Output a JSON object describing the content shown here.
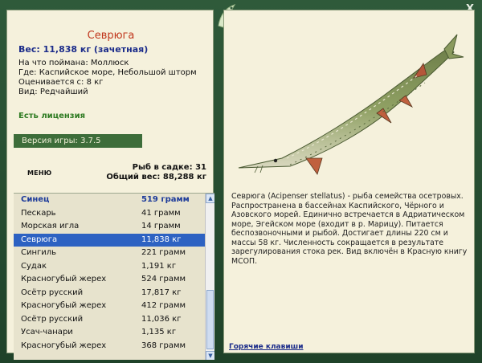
{
  "window": {
    "close_label": "X"
  },
  "fish": {
    "name": "Севрюга",
    "weight_line": "Вес: 11,838 кг (зачетная)",
    "bait": "На что поймана: Моллюск",
    "place": "Где: Каспийское море, Небольшой шторм",
    "value": "Оценивается с: 8 кг",
    "kind": "Вид: Редчайший",
    "license": "Есть лицензия",
    "description": "Севрюга (Acipenser stellatus) - рыба семейства осетровых. Распространена в бассейнах Каспийского, Чёрного и Азовского морей. Единично встречается в Адриатическом море, Эгейском море (входит в р. Марицу). Питается беспозвоночными и рыбой. Достигает длины 220 см и массы 58 кг. Численность сокращается в результате зарегулирования стока рек. Вид включён в Красную книгу МСОП."
  },
  "game": {
    "version": "Версия игры: 3.7.5"
  },
  "menu": {
    "label": "МЕНЮ"
  },
  "totals": {
    "count_line": "Рыб в садке: 31",
    "weight_line": "Общий вес: 88,288 кг"
  },
  "catch_list": [
    {
      "name": "Синец",
      "weight": "519 грамм",
      "state": "header"
    },
    {
      "name": "Пескарь",
      "weight": "41 грамм",
      "state": "normal"
    },
    {
      "name": "Морская игла",
      "weight": "14 грамм",
      "state": "normal"
    },
    {
      "name": "Севрюга",
      "weight": "11,838 кг",
      "state": "selected"
    },
    {
      "name": "Сингиль",
      "weight": "221 грамм",
      "state": "normal"
    },
    {
      "name": "Судак",
      "weight": "1,191 кг",
      "state": "normal"
    },
    {
      "name": "Красногубый жерех",
      "weight": "524 грамм",
      "state": "normal"
    },
    {
      "name": "Осётр русский",
      "weight": "17,817 кг",
      "state": "normal"
    },
    {
      "name": "Красногубый жерех",
      "weight": "412 грамм",
      "state": "normal"
    },
    {
      "name": "Осётр русский",
      "weight": "11,036 кг",
      "state": "normal"
    },
    {
      "name": "Усач-чанари",
      "weight": "1,135 кг",
      "state": "normal"
    },
    {
      "name": "Красногубый жерех",
      "weight": "368 грамм",
      "state": "normal"
    }
  ],
  "footer": {
    "hotkeys_label": "Горячие клавиши"
  },
  "icons": {
    "close": "close-icon",
    "logo": "fish-logo-icon",
    "scroll_up": "arrow-up-icon",
    "scroll_down": "arrow-down-icon"
  }
}
